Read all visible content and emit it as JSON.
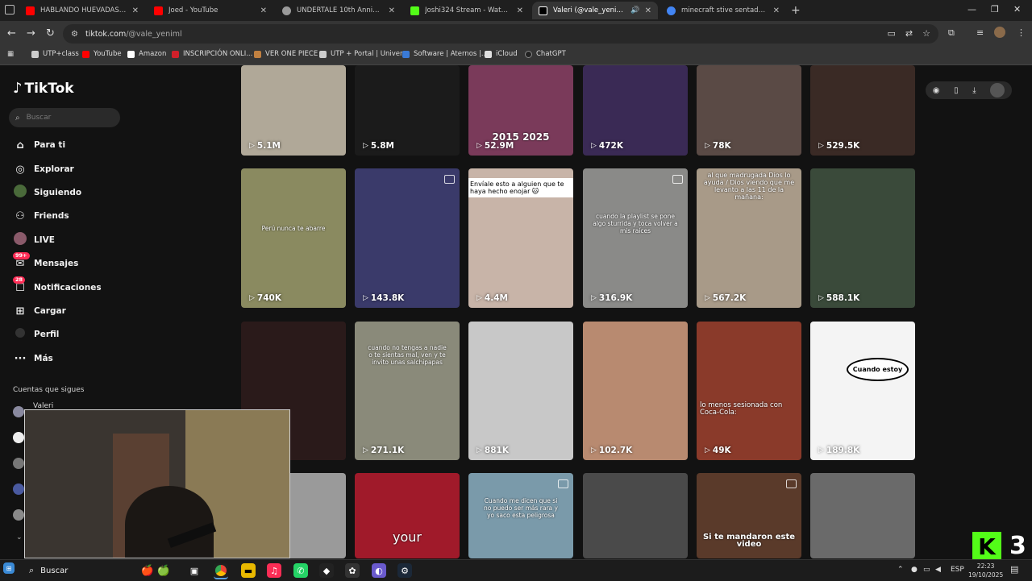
{
  "browser": {
    "tabs": [
      {
        "title": "HABLANDO HUEVADAS - \"JORG",
        "favicon_color": "#ff0000",
        "active": false
      },
      {
        "title": "Joed - YouTube",
        "favicon_color": "#ff0000",
        "active": false
      },
      {
        "title": "UNDERTALE 10th Anniversary",
        "favicon_color": "#9a9a9a",
        "active": false
      },
      {
        "title": "Joshi324 Stream - Watch Live o",
        "favicon_color": "#53fc18",
        "active": false
      },
      {
        "title": "Valeri (@vale_yeniml) | TikT",
        "favicon_color": "#ffffff",
        "active": true
      },
      {
        "title": "minecraft stive sentado - Busca",
        "favicon_color": "#4285f4",
        "active": false
      }
    ],
    "url_host": "tiktok.com",
    "url_path": "/@vale_yeniml",
    "bookmarks": [
      {
        "label": "UTP+class",
        "color": "#cccccc"
      },
      {
        "label": "YouTube",
        "color": "#ff0000"
      },
      {
        "label": "Amazon",
        "color": "#ffffff"
      },
      {
        "label": "INSCRIPCIÓN ONLI...",
        "color": "#d0202a"
      },
      {
        "label": "VER ONE PIECE",
        "color": "#c08040"
      },
      {
        "label": "UTP + Portal | Univer...",
        "color": "#cccccc"
      },
      {
        "label": "Software | Aternos |...",
        "color": "#3a7ad6"
      },
      {
        "label": "iCloud",
        "color": "#e0e0e0"
      },
      {
        "label": "ChatGPT",
        "color": "#222222"
      }
    ]
  },
  "tiktok": {
    "logo": "TikTok",
    "search_placeholder": "Buscar",
    "nav": [
      {
        "label": "Para ti",
        "icon": "home-icon"
      },
      {
        "label": "Explorar",
        "icon": "compass-icon"
      },
      {
        "label": "Siguiendo",
        "icon": "following-icon"
      },
      {
        "label": "Friends",
        "icon": "friends-icon"
      },
      {
        "label": "LIVE",
        "icon": "live-icon"
      },
      {
        "label": "Mensajes",
        "icon": "messages-icon",
        "badge": "99+"
      },
      {
        "label": "Notificaciones",
        "icon": "notifications-icon",
        "badge": "28"
      },
      {
        "label": "Cargar",
        "icon": "upload-icon"
      },
      {
        "label": "Perfil",
        "icon": "profile-icon"
      },
      {
        "label": "Más",
        "icon": "more-icon"
      }
    ],
    "following_heading": "Cuentas que sigues",
    "following_first": "Valeri",
    "videos": [
      {
        "views": "5.1M",
        "caption": "",
        "bg": "#b0a898"
      },
      {
        "views": "5.8M",
        "caption": "",
        "bg": "#1b1b1b"
      },
      {
        "views": "52.9M",
        "caption": "2015  2025",
        "bg": "#7a3a5a"
      },
      {
        "views": "472K",
        "caption": "",
        "bg": "#3a2a55"
      },
      {
        "views": "78K",
        "caption": "",
        "bg": "#5a4a45"
      },
      {
        "views": "529.5K",
        "caption": "",
        "bg": "#3a2a25"
      },
      {
        "views": "740K",
        "caption": "Perú nunca te abarre",
        "bg": "#8a8a60"
      },
      {
        "views": "143.8K",
        "caption": "",
        "bg": "#3a3a6a"
      },
      {
        "views": "4.4M",
        "caption": "Envíale esto a alguien que te haya hecho enojar 🐱",
        "bg": "#c8b4a8"
      },
      {
        "views": "316.9K",
        "caption": "cuando la playlist se pone algo sturrida y toca volver a mis raíces",
        "bg": "#8a8a88"
      },
      {
        "views": "567.2K",
        "caption": "al que madrugada Dios lo ayuda / Dios viendo que me levanto a las 11 de la mañana:",
        "bg": "#a89a88"
      },
      {
        "views": "588.1K",
        "caption": "",
        "bg": "#3a4a3a"
      },
      {
        "views": "",
        "caption": "",
        "bg": "#2a1a1a"
      },
      {
        "views": "271.1K",
        "caption": "cuando no tengas a nadie o te sientas mal, ven y te invito unas salchipapas",
        "bg": "#8a8a7a"
      },
      {
        "views": "881K",
        "caption": "",
        "bg": "#c8c8c8"
      },
      {
        "views": "102.7K",
        "caption": "",
        "bg": "#b88a70"
      },
      {
        "views": "49K",
        "caption": "lo menos sesionada con Coca-Cola:",
        "bg": "#8a3a2a"
      },
      {
        "views": "189.8K",
        "caption": "Cuando estoy",
        "bg": "#f4f4f4"
      },
      {
        "views": "",
        "caption": "",
        "bg": "#9a9a9a"
      },
      {
        "views": "",
        "caption": "your",
        "bg": "#a01a2a"
      },
      {
        "views": "",
        "caption": "Cuando me dicen que si no puedo ser más rara y yo saco esta peligrosa",
        "bg": "#7a9aaa"
      },
      {
        "views": "",
        "caption": "",
        "bg": "#4a4a4a"
      },
      {
        "views": "",
        "caption": "Si te mandaron este video",
        "bg": "#5a3a2a"
      },
      {
        "views": "",
        "caption": "",
        "bg": "#6a6a6a"
      }
    ]
  },
  "taskbar": {
    "search_label": "Buscar",
    "language": "ESP",
    "time": "22:23",
    "date": "19/10/2025"
  },
  "overlay": {
    "kick_mark": "K",
    "kick_number": "3"
  }
}
